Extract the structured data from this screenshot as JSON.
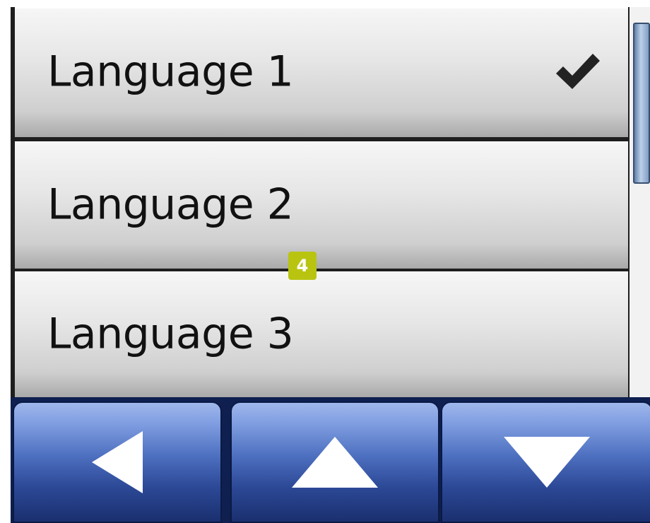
{
  "languages": [
    {
      "label": "Language 1",
      "selected": true
    },
    {
      "label": "Language 2",
      "selected": false
    },
    {
      "label": "Language 3",
      "selected": false
    }
  ],
  "badge": "4",
  "icons": {
    "selected": "checkmark-icon",
    "back": "triangle-left-icon",
    "up": "triangle-up-icon",
    "down": "triangle-down-icon"
  },
  "colors": {
    "nav_button": "#4d6fbf",
    "badge": "#b9c411",
    "scroll_thumb": "#7f9ec6"
  }
}
